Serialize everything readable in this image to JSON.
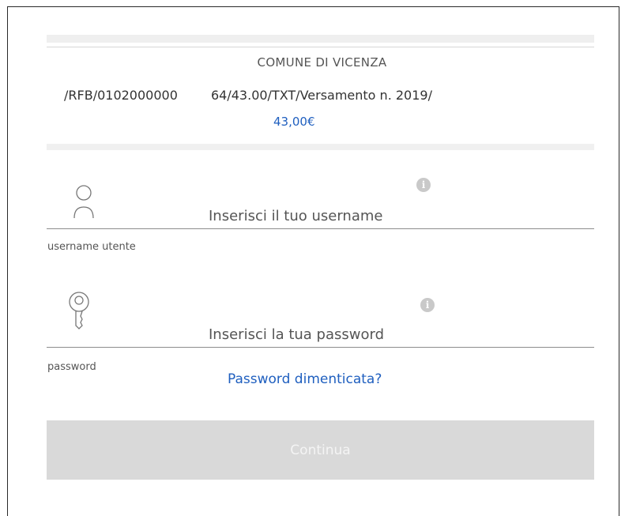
{
  "payment": {
    "payee": "COMUNE DI VICENZA",
    "causale_left": "/RFB/0102000000",
    "causale_right": "64/43.00/TXT/Versamento n. 2019/",
    "amount": "43,00€"
  },
  "username": {
    "placeholder": "Inserisci il tuo username",
    "label": "username utente",
    "icon": "user-icon"
  },
  "password": {
    "placeholder": "Inserisci la tua password",
    "label": "password",
    "icon": "key-icon"
  },
  "forgot_password": "Password dimenticata?",
  "continue_label": "Continua",
  "colors": {
    "link": "#1f5fbf",
    "button_disabled": "#d9d9d9",
    "info_icon": "#c9c9c9"
  }
}
